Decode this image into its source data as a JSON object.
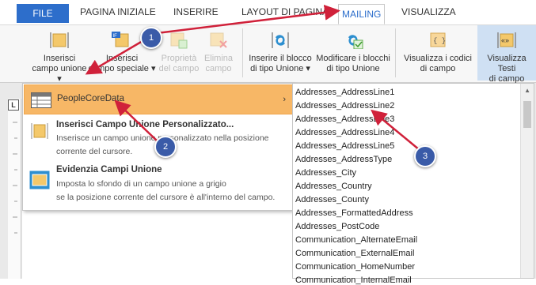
{
  "tabs": {
    "file": "FILE",
    "home": "PAGINA INIZIALE",
    "insert": "INSERIRE",
    "layout": "LAYOUT DI PAGINA",
    "mailing": "MAILING",
    "view": "VISUALIZZA"
  },
  "ribbon": {
    "insert_merge_field": [
      "Inserisci",
      "campo unione ▾"
    ],
    "insert_special_field": [
      "Inserisci",
      "campo speciale ▾"
    ],
    "field_properties": [
      "Proprietà",
      "del campo"
    ],
    "delete_field": [
      "Elimina",
      "campo"
    ],
    "insert_union_block": [
      "Inserire il blocco",
      "di tipo Unione ▾"
    ],
    "modify_union_blocks": [
      "Modificare i blocchi",
      "di tipo Unione"
    ],
    "show_field_codes": [
      "Visualizza i codici",
      "di campo"
    ],
    "show_field_text": [
      "Visualizza Testi",
      "di campo"
    ],
    "if_badge": "IF",
    "field_code_glyph": "{ }",
    "field_text_glyph": "«»"
  },
  "ruler": {
    "corner": "L"
  },
  "dropdown": {
    "datasource": "PeopleCoreData",
    "custom_title": "Inserisci Campo Unione Personalizzato...",
    "custom_desc_1": "Inserisce un campo unione personalizzato nella posizione",
    "custom_desc_2": "corrente del cursore.",
    "highlight_title": "Evidenzia Campi Unione",
    "highlight_desc_1": "Imposta lo sfondo di un campo unione a grigio",
    "highlight_desc_2": "se la posizione corrente del cursore è all'interno del campo."
  },
  "fields": [
    "Addresses_AddressLine1",
    "Addresses_AddressLine2",
    "Addresses_AddressLine3",
    "Addresses_AddressLine4",
    "Addresses_AddressLine5",
    "Addresses_AddressType",
    "Addresses_City",
    "Addresses_Country",
    "Addresses_County",
    "Addresses_FormattedAddress",
    "Addresses_PostCode",
    "Communication_AlternateEmail",
    "Communication_ExternalEmail",
    "Communication_HomeNumber",
    "Communication_InternalEmail"
  ],
  "callouts": [
    "1",
    "2",
    "3"
  ],
  "colors": {
    "accent": "#2d6ecb",
    "highlight": "#f7b766",
    "arrow": "#d0213a",
    "badge": "#3a5ba8"
  }
}
